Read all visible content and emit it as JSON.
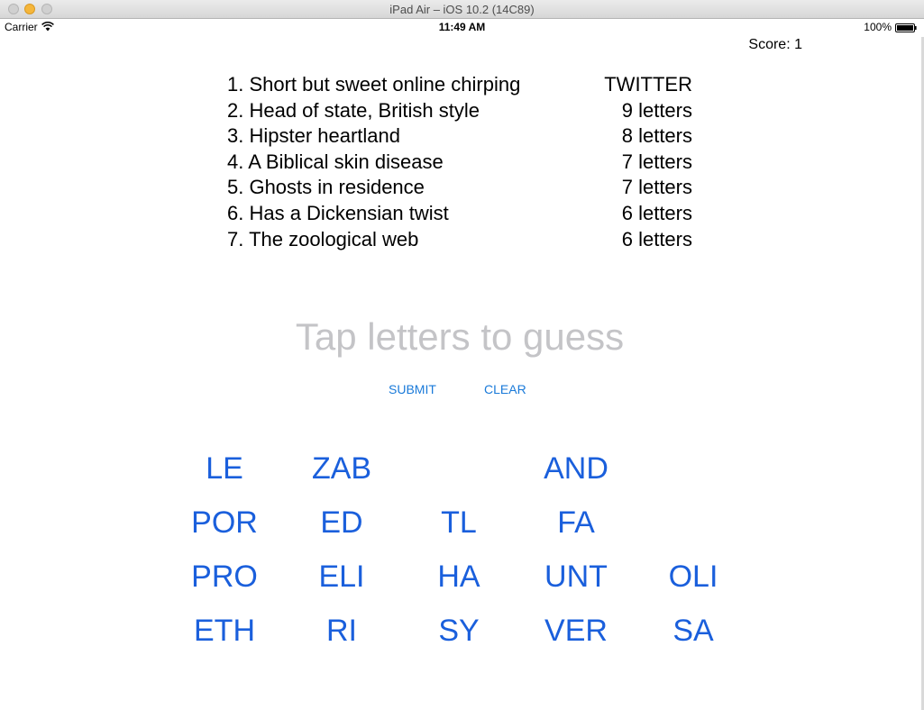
{
  "window": {
    "title": "iPad Air – iOS 10.2 (14C89)"
  },
  "status_bar": {
    "carrier": "Carrier",
    "time": "11:49 AM",
    "battery": "100%"
  },
  "score": "Score: 1",
  "clues": [
    {
      "text": "1. Short but sweet online chirping",
      "answer": "TWITTER"
    },
    {
      "text": "2. Head of state, British style",
      "answer": "9 letters"
    },
    {
      "text": "3. Hipster heartland",
      "answer": "8 letters"
    },
    {
      "text": "4. A Biblical skin disease",
      "answer": "7 letters"
    },
    {
      "text": "5. Ghosts in residence",
      "answer": "7 letters"
    },
    {
      "text": "6. Has a Dickensian twist",
      "answer": "6 letters"
    },
    {
      "text": "7. The zoological web",
      "answer": "6 letters"
    }
  ],
  "guess_placeholder": "Tap letters to guess",
  "buttons": {
    "submit": "SUBMIT",
    "clear": "CLEAR"
  },
  "tiles": [
    [
      "LE",
      "ZAB",
      "",
      "AND",
      ""
    ],
    [
      "POR",
      "ED",
      "TL",
      "FA",
      ""
    ],
    [
      "PRO",
      "ELI",
      "HA",
      "UNT",
      "OLI"
    ],
    [
      "ETH",
      "RI",
      "SY",
      "VER",
      "SA"
    ]
  ],
  "colors": {
    "tile": "#1a5fdc",
    "button": "#1a7ad9",
    "placeholder": "#c4c4c7"
  }
}
